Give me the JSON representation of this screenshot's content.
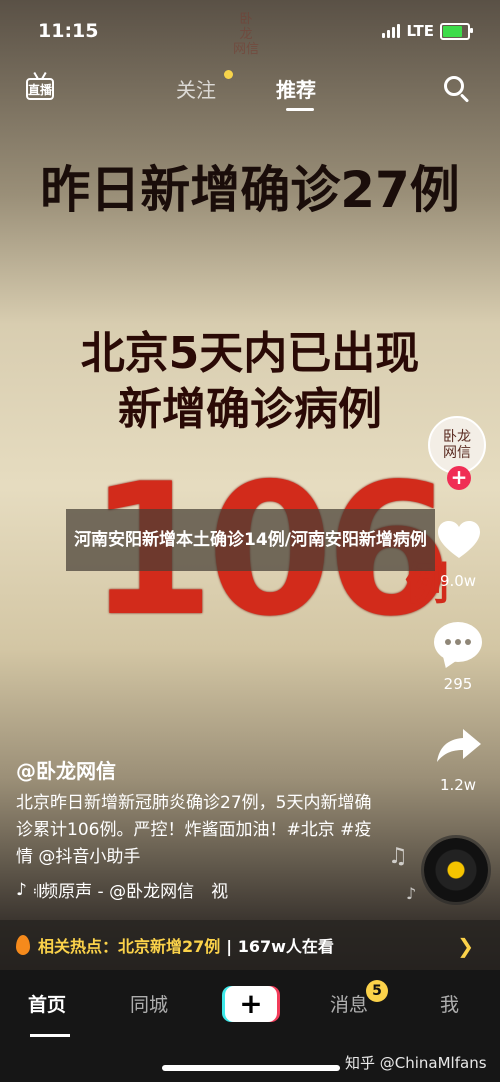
{
  "status_bar": {
    "time": "11:15",
    "network": "LTE",
    "battery_fraction": 0.8
  },
  "watermark_top": "卧龙网信",
  "top_nav": {
    "live_label": "直播",
    "tabs": [
      {
        "label": "关注"
      },
      {
        "label": "推荐"
      }
    ],
    "active_tab": "推荐"
  },
  "video": {
    "line1": "昨日新增确诊27例",
    "line2a": "北京5天内已出现",
    "line2b": "新增确诊病例",
    "number": "106",
    "unit": "例"
  },
  "banner_title": "河南安阳新增本土确诊14例/河南安阳新增病例",
  "side_actions": {
    "avatar_text": "卧龙网信",
    "likes": "9.0w",
    "comments": "295",
    "shares": "1.2w"
  },
  "caption": {
    "author": "@卧龙网信",
    "text": "北京昨日新增新冠肺炎确诊27例，5天内新增确诊累计106例。严控！炸酱面加油！#北京 #疫情 @抖音小助手",
    "music": "𝄇频原声 - @卧龙网信　视"
  },
  "hot_bar": {
    "label": "相关热点：",
    "topic": "北京新增27例",
    "views": "| 167w人在看"
  },
  "bottom_nav": {
    "home": "首页",
    "city": "同城",
    "create": "+",
    "messages": "消息",
    "message_badge": "5",
    "me": "我"
  },
  "site_watermark": "知乎 @ChinaMlfans",
  "colors": {
    "accent_red": "#d22b1b",
    "hot_yellow": "#fbd24a",
    "create_cyan": "#3ee8e9",
    "create_pink": "#f23c5a"
  }
}
